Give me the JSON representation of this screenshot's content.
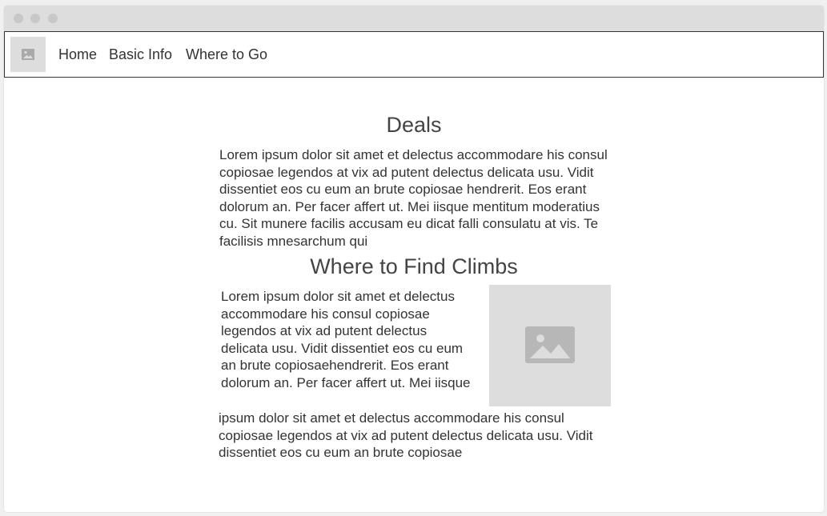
{
  "nav": {
    "links": [
      "Home",
      "Basic Info",
      "Where to Go"
    ]
  },
  "deals": {
    "heading": "Deals",
    "text": "Lorem ipsum dolor sit amet et delectus accommodare his consul copiosae legendos at vix ad putent delectus delicata usu. Vidit dissentiet eos cu eum an brute copiosae hendrerit. Eos erant dolorum an. Per facer affert ut. Mei iisque mentitum moderatius cu. Sit munere facilis accusam eu dicat falli consulatu at vis. Te facilisis mnesarchum qui"
  },
  "climbs": {
    "heading": "Where to Find Climbs",
    "text_top": "Lorem ipsum dolor sit amet et delectus accommodare his consul copiosae legendos at vix ad putent delectus delicata usu. Vidit dissentiet eos cu eum an brute copiosaehendrerit. Eos erant dolorum an. Per facer affert ut. Mei iisque",
    "text_bottom": "ipsum dolor sit amet et delectus accommodare his consul copiosae legendos at vix ad putent delectus delicata usu. Vidit dissentiet eos cu eum an brute copiosae"
  },
  "icons": {
    "logo": "image-icon",
    "climb_image": "image-icon"
  },
  "colors": {
    "placeholder": "#dddddd",
    "placeholder_icon": "#b0b0b0",
    "text": "#333333"
  }
}
